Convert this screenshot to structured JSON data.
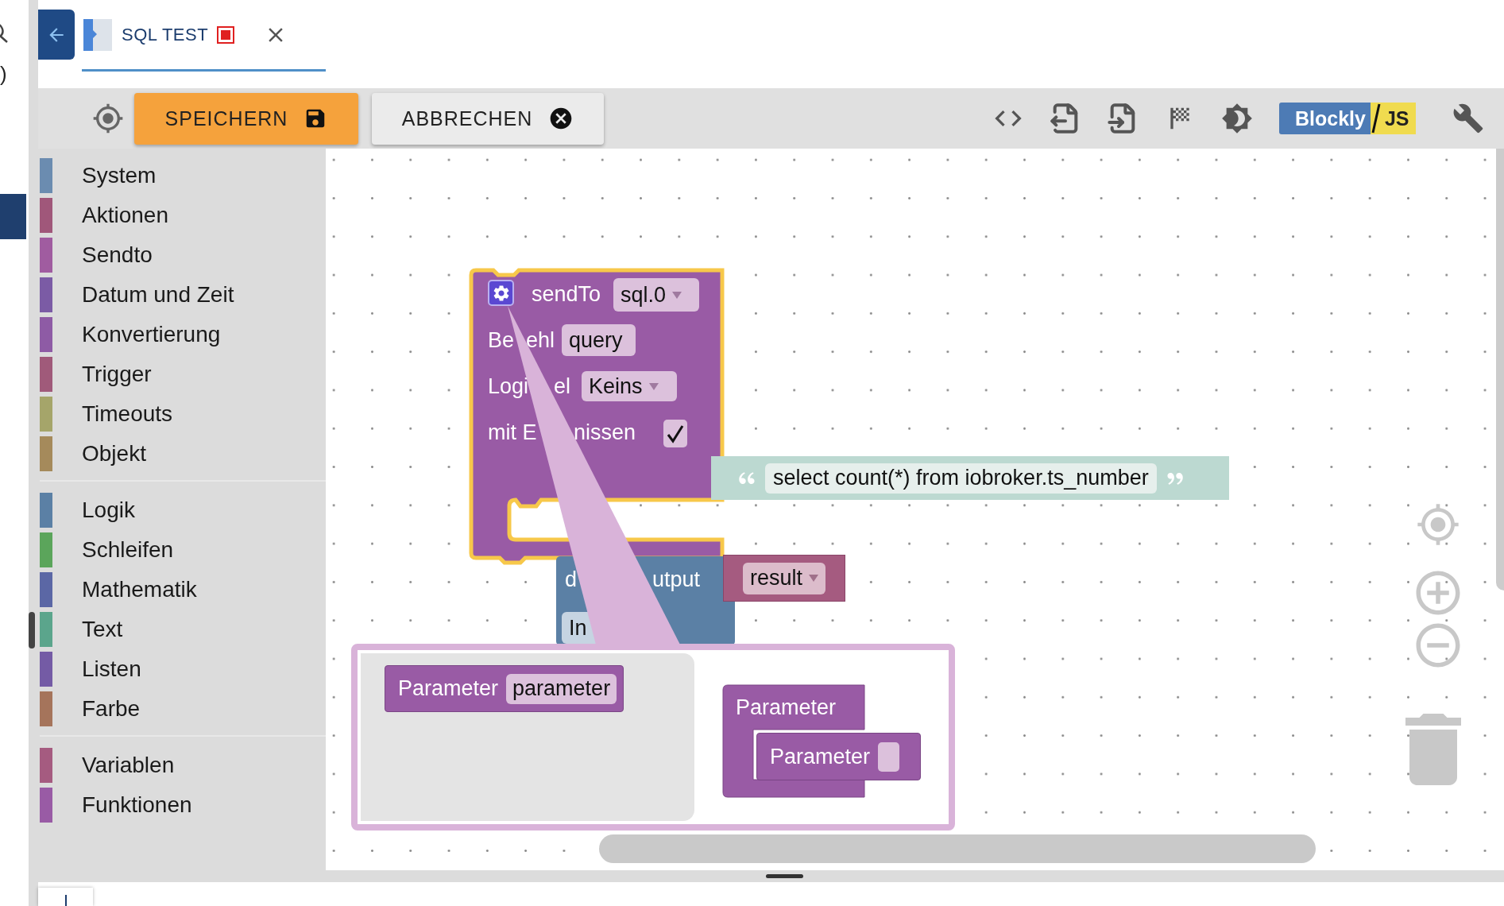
{
  "side_strip": {
    "text": ")"
  },
  "tab": {
    "title": "SQL TEST"
  },
  "toolbar": {
    "buttons": [
      {
        "label": "SPEICHERN",
        "kind": "primary"
      },
      {
        "label": "ABBRECHEN",
        "kind": "secondary"
      }
    ],
    "logo": {
      "left": "Blockly",
      "right": "JS"
    }
  },
  "categories": [
    {
      "items": [
        {
          "label": "System",
          "color": "#6b8cb0"
        },
        {
          "label": "Aktionen",
          "color": "#a0577a"
        },
        {
          "label": "Sendto",
          "color": "#a05ca0"
        },
        {
          "label": "Datum und Zeit",
          "color": "#7b5ba5"
        },
        {
          "label": "Konvertierung",
          "color": "#8e5ba5"
        },
        {
          "label": "Trigger",
          "color": "#a05a7a"
        },
        {
          "label": "Timeouts",
          "color": "#a5a56a"
        },
        {
          "label": "Objekt",
          "color": "#a58a5b"
        }
      ]
    },
    {
      "items": [
        {
          "label": "Logik",
          "color": "#5b80a5"
        },
        {
          "label": "Schleifen",
          "color": "#5ba55b"
        },
        {
          "label": "Mathematik",
          "color": "#5b67a5"
        },
        {
          "label": "Text",
          "color": "#5ba58c"
        },
        {
          "label": "Listen",
          "color": "#745ba5"
        },
        {
          "label": "Farbe",
          "color": "#a5745b"
        }
      ]
    },
    {
      "items": [
        {
          "label": "Variablen",
          "color": "#a55b80"
        },
        {
          "label": "Funktionen",
          "color": "#995ba5"
        }
      ]
    }
  ],
  "workspace": {
    "send_block": {
      "selected": true,
      "label": "sendTo",
      "instance": "sql.0",
      "rows": [
        {
          "kind": "text",
          "label_parts": [
            "Be",
            "ehl"
          ],
          "value": "query"
        },
        {
          "kind": "dropdown",
          "label_parts": [
            "Logi",
            "el"
          ],
          "value": "Keins"
        },
        {
          "kind": "checkbox",
          "label_parts": [
            "mit E",
            "nissen"
          ],
          "checked": true
        }
      ]
    },
    "text_block": {
      "value": "select count(*) from iobroker.ts_number"
    },
    "debug_block": {
      "label_parts": [
        "d",
        "utput"
      ],
      "input": "In"
    },
    "var_block": {
      "value": "result"
    },
    "mutator": {
      "flyout_block": {
        "label": "Parameter",
        "value": "parameter"
      },
      "container": {
        "label": "Parameter"
      },
      "item": {
        "label": "Parameter"
      }
    }
  }
}
